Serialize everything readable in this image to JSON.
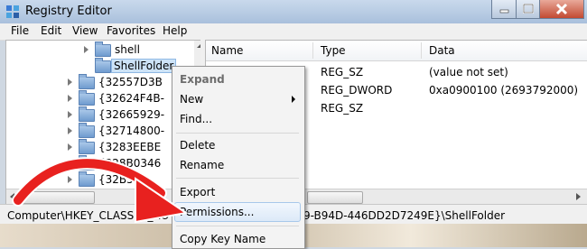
{
  "window": {
    "title": "Registry Editor"
  },
  "menubar": [
    "File",
    "Edit",
    "View",
    "Favorites",
    "Help"
  ],
  "tree": {
    "items": [
      {
        "label": "shell"
      },
      {
        "label": "ShellFolder"
      },
      {
        "label": "{32557D3B"
      },
      {
        "label": "{32624F4B-"
      },
      {
        "label": "{32665929-"
      },
      {
        "label": "{32714800-"
      },
      {
        "label": "{3283EEBE"
      },
      {
        "label": "{328B0346"
      },
      {
        "label": "{32B533"
      }
    ]
  },
  "list": {
    "columns": [
      "Name",
      "Type",
      "Data"
    ],
    "rows": [
      {
        "type": "REG_SZ",
        "data": "(value not set)"
      },
      {
        "type": "REG_DWORD",
        "data": "0xa0900100 (2693792000)"
      },
      {
        "type": "REG_SZ",
        "data": ""
      }
    ]
  },
  "statusbar": {
    "path_left": "Computer\\HKEY_CLASSES_RO",
    "path_right": "9-B94D-446DD2D7249E}\\ShellFolder"
  },
  "context_menu": {
    "items": [
      "Expand",
      "New",
      "Find...",
      "Delete",
      "Rename",
      "Export",
      "Permissions...",
      "Copy Key Name"
    ]
  },
  "colors": {
    "arrow": "#e8211f",
    "selection": "#cde3f7",
    "menu_hover": "#dce9f8"
  }
}
